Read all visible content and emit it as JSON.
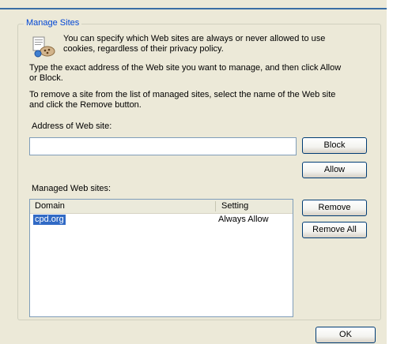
{
  "group": {
    "title": "Manage Sites",
    "intro": "You can specify which Web sites are always or never allowed to use cookies, regardless of their privacy policy.",
    "intro_line1": "You can specify which Web sites are always or never allowed to use",
    "intro_line2": "cookies, regardless of their privacy policy.",
    "instruction1_line1": "Type the exact address of the Web site you want to manage, and then click Allow",
    "instruction1_line2": "or Block.",
    "instruction2_line1": "To remove a site from the list of managed sites, select the name of the Web site",
    "instruction2_line2": "and click the Remove button.",
    "address_label": "Address of Web site:",
    "address_value": "",
    "managed_label": "Managed Web sites:"
  },
  "buttons": {
    "block": "Block",
    "allow": "Allow",
    "remove": "Remove",
    "remove_all": "Remove All",
    "ok": "OK"
  },
  "table": {
    "columns": [
      "Domain",
      "Setting"
    ],
    "rows": [
      {
        "domain": "cpd.org",
        "setting": "Always Allow",
        "selected": true
      }
    ]
  },
  "colors": {
    "dialog_bg": "#ece9d8",
    "legend_text": "#0046d5",
    "selection": "#316ac5",
    "border_blue": "#003c74"
  },
  "icons": {
    "intro": "cookie-globe-icon"
  }
}
